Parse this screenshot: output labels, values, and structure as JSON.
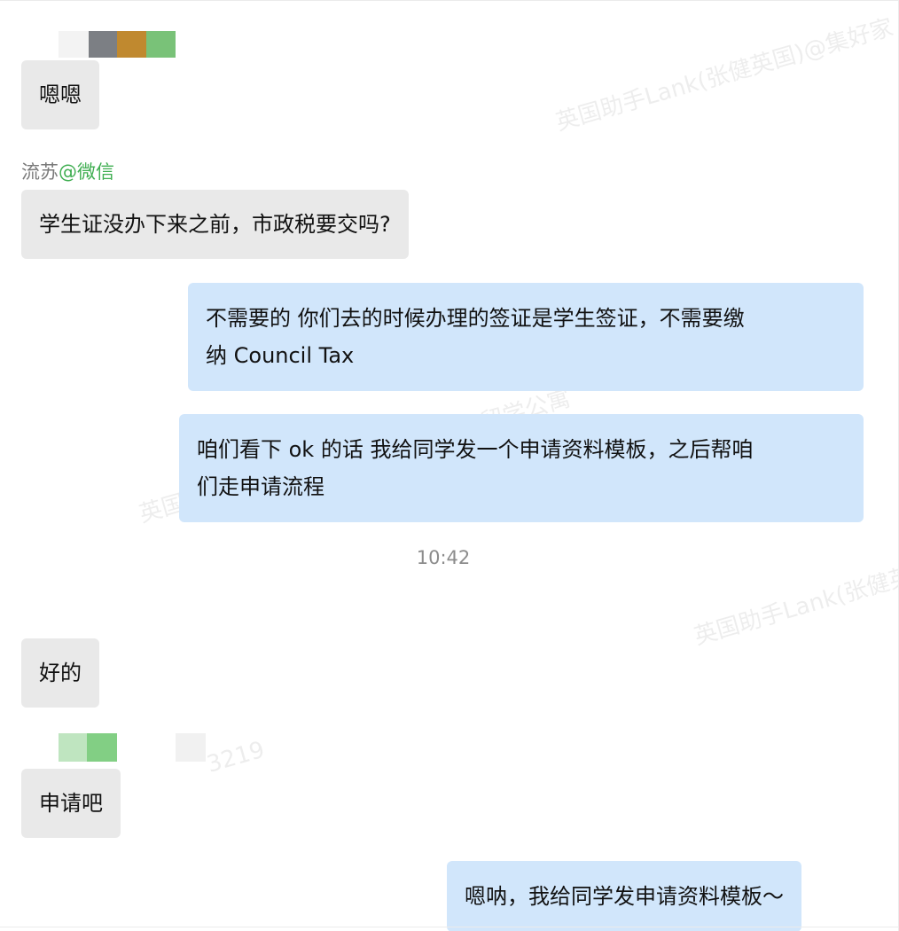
{
  "watermarks": [
    "英国助手Lank(张健英国)@集好家",
    "英国助手Lank(张健英",
    "集好家留学公寓",
    "英国",
    "3219"
  ],
  "messages": {
    "m1": "嗯嗯",
    "m2_sender_name": "流苏",
    "m2_sender_source": "@微信",
    "m2": "学生证没办下来之前，市政税要交吗?",
    "m3_line1": "不需要的 你们去的时候办理的签证是学生签证，不需要缴",
    "m3_line2": "纳 Council Tax",
    "m4_line1": "咱们看下 ok 的话 我给同学发一个申请资料模板，之后帮咱",
    "m4_line2": "们走申请流程",
    "time": "10:42",
    "m5": "好的",
    "m6": "申请吧",
    "m7": "嗯呐，我给同学发申请资料模板～"
  },
  "colors": {
    "incoming_bubble": "#e9e9e9",
    "outgoing_bubble": "#d1e6fb",
    "sender_source": "#3fae51",
    "timestamp": "#8c8c8c"
  }
}
